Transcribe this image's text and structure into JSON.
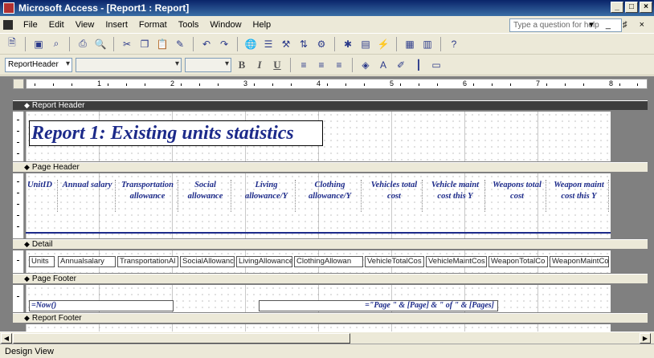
{
  "window": {
    "title": "Microsoft Access - [Report1 : Report]",
    "min": "_",
    "max": "□",
    "close": "×"
  },
  "menu": {
    "items": [
      "File",
      "Edit",
      "View",
      "Insert",
      "Format",
      "Tools",
      "Window",
      "Help"
    ],
    "help_placeholder": "Type a question for help",
    "right_controls": "▾ _ ♯ ×"
  },
  "toolbar2": {
    "object_combo": "ReportHeader",
    "bold": "B",
    "italic": "I",
    "underline": "U"
  },
  "ruler": {
    "marks": [
      "1",
      "2",
      "3",
      "4",
      "5",
      "6",
      "7",
      "8"
    ]
  },
  "sections": {
    "report_header": "Report Header",
    "page_header": "Page Header",
    "detail": "Detail",
    "page_footer": "Page Footer",
    "report_footer": "Report Footer"
  },
  "report_title": "Report 1: Existing units statistics",
  "column_headers": [
    "UnitID",
    "Annual salary",
    "Transportation allowance",
    "Social allowance",
    "Living allowance/Y",
    "Clothing allowance/Y",
    "Vehicles total cost",
    "Vehicle maint cost this Y",
    "Weapons total cost",
    "Weapon maint cost this Y"
  ],
  "detail_fields": [
    "Units",
    "Annualsalary",
    "TransportationAl",
    "SocialAllowance",
    "LivingAllowance",
    "ClothingAllowan",
    "VehicleTotalCos",
    "VehicleMaintCos",
    "WeaponTotalCo",
    "WeaponMaintCo"
  ],
  "page_footer": {
    "now_field": "=Now()",
    "page_field": "=\"Page \" & [Page] & \" of \" & [Pages]"
  },
  "status": {
    "text": "Design View"
  }
}
